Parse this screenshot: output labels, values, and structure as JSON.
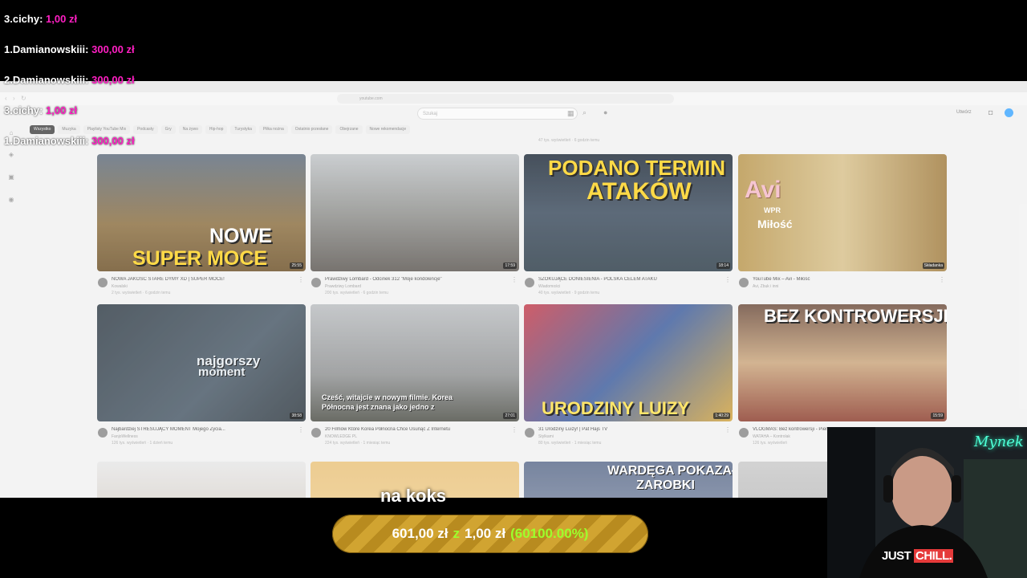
{
  "donations": [
    {
      "name": "3.cichy:",
      "amount": "1,00 zł"
    },
    {
      "name": "1.Damianowskiii:",
      "amount": "300,00 zł"
    },
    {
      "name": "2.Damianowskiii:",
      "amount": "300,00 zł"
    },
    {
      "name": "3.cichy:",
      "amount": "1,00 zł"
    },
    {
      "name": "1.Damianowskiii:",
      "amount": "300,00 zł"
    }
  ],
  "browser": {
    "url": "youtube.com",
    "search_placeholder": "Szukaj",
    "signin_label": "Utwórz",
    "top_meta": "47 tys. wyświetleń · 6 godzin temu"
  },
  "chips": [
    "Wszystko",
    "Muzyka",
    "Playlisty YouTube Mix",
    "Podcasty",
    "Gry",
    "Na żywo",
    "Hip-hop",
    "Turystyka",
    "Piłka nożna",
    "Ostatnio przesłane",
    "Obejrzane",
    "Nowe rekomendacje"
  ],
  "sidebar": [
    {
      "icon": "home-icon",
      "glyph": "⌂"
    },
    {
      "icon": "shorts-icon",
      "glyph": "◈"
    },
    {
      "icon": "subscriptions-icon",
      "glyph": "▣"
    },
    {
      "icon": "you-icon",
      "glyph": "◉"
    }
  ],
  "videos": [
    {
      "title": "NOWA JAKOŚĆ STARE DYMY XD | SUPER MOCE!",
      "channel": "Kowalski",
      "meta": "2 tys. wyświetleń · 6 godzin temu",
      "duration": "25:55",
      "thumb_text": [
        "NOWE",
        "SUPER MOCE"
      ]
    },
    {
      "title": "Prawdziwy Lombard - Odcinek 312 \"Moje kondolencje\"",
      "channel": "Prawdziwy Lombard",
      "meta": "200 tys. wyświetleń · 6 godzin temu",
      "duration": "17:59",
      "thumb_text": []
    },
    {
      "title": "SZOKUJĄCE DONIESIENIA - POLSKA CELEM ATAKU",
      "channel": "Wiadomości",
      "meta": "40 tys. wyświetleń · 9 godzin temu",
      "duration": "18:14",
      "thumb_text": [
        "PODANO TERMIN",
        "ATAKÓW"
      ]
    },
    {
      "title": "YouTube Mix – Avi - Miłość",
      "channel": "Avi, Zbuk i inni",
      "meta": "",
      "duration": "Składanka",
      "thumb_text": [
        "Avi",
        "WPR",
        "Miłość"
      ]
    },
    {
      "title": "Najbardziej STRESUJĄCY MOMENT Mojego Życia...",
      "channel": "FanjoWellness",
      "meta": "126 tys. wyświetleń · 1 dzień temu",
      "duration": "38:58",
      "thumb_text": [
        "najgorszy",
        "moment"
      ]
    },
    {
      "title": "20 Filmów Które Korea Północna Chce Usunąć Z Internetu",
      "channel": "KNOWLEDGE PL",
      "meta": "224 tys. wyświetleń · 1 miesiąc temu",
      "duration": "27:01",
      "thumb_text": [
        "Cześć, witajcie w nowym filmie. Korea",
        "Północna jest znana jako jedno z"
      ]
    },
    {
      "title": "31 Urodziny Luizy! | Pat Hajs TV",
      "channel": "Stylkami",
      "meta": "80 tys. wyświetleń · 1 miesiąc temu",
      "duration": "1:40:29",
      "thumb_text": [
        "URODZINY LUIZY"
      ]
    },
    {
      "title": "VLOGMAS: Bez kontrowersji - Pier...",
      "channel": "WATAHA – Kontrolak",
      "meta": "126 tys. wyświetleń",
      "duration": "15:59",
      "thumb_text": [
        "BEZ KONTROWERSJI"
      ]
    },
    {
      "title": "",
      "channel": "",
      "meta": "",
      "duration": "",
      "thumb_text": []
    },
    {
      "title": "",
      "channel": "",
      "meta": "",
      "duration": "",
      "thumb_text": []
    },
    {
      "title": "",
      "channel": "",
      "meta": "",
      "duration": "",
      "thumb_text": [
        "WARDĘGA POKAZAŁ",
        "ZAROBKI"
      ]
    },
    {
      "title": "",
      "channel": "",
      "meta": "",
      "duration": "",
      "thumb_text": []
    }
  ],
  "caption": "na koks",
  "goal": {
    "current": "601,00 zł",
    "separator": "z",
    "target": "1,00 zł",
    "percent": "(60100.00%)"
  },
  "webcam": {
    "neon": "Mynek",
    "shirt_a": "JUST",
    "shirt_b": "CHILL."
  },
  "colors": {
    "donation_amount": "#ff1fc3",
    "goal_highlight": "#9dff2c",
    "goal_bar": "#c49a2a",
    "neon": "#4dffd6"
  }
}
